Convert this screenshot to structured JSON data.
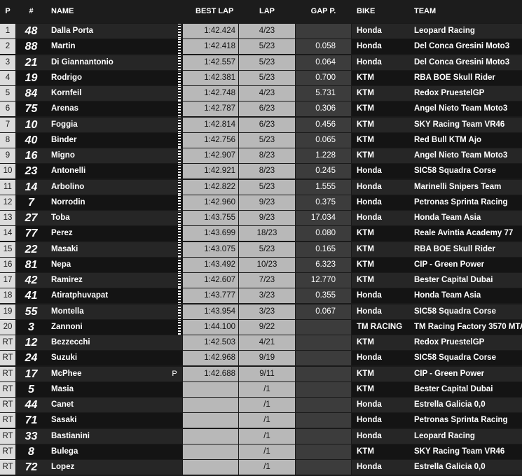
{
  "headers": {
    "pos": "P",
    "num": "#",
    "name": "NAME",
    "best_lap": "BEST LAP",
    "lap": "LAP",
    "gap": "GAP P.",
    "bike": "BIKE",
    "team": "TEAM"
  },
  "rows": [
    {
      "pos": "1",
      "num": "48",
      "name": "Dalla Porta",
      "best": "1:42.424",
      "lap": "4/23",
      "gap": "",
      "bike": "Honda",
      "team": "Leopard Racing"
    },
    {
      "pos": "2",
      "num": "88",
      "name": "Martin",
      "best": "1:42.418",
      "lap": "5/23",
      "gap": "0.058",
      "bike": "Honda",
      "team": "Del Conca Gresini Moto3"
    },
    {
      "pos": "3",
      "num": "21",
      "name": "Di Giannantonio",
      "best": "1:42.557",
      "lap": "5/23",
      "gap": "0.064",
      "bike": "Honda",
      "team": "Del Conca Gresini Moto3"
    },
    {
      "pos": "4",
      "num": "19",
      "name": "Rodrigo",
      "best": "1:42.381",
      "lap": "5/23",
      "gap": "0.700",
      "bike": "KTM",
      "team": "RBA BOE Skull Rider"
    },
    {
      "pos": "5",
      "num": "84",
      "name": "Kornfeil",
      "best": "1:42.748",
      "lap": "4/23",
      "gap": "5.731",
      "bike": "KTM",
      "team": "Redox PruestelGP"
    },
    {
      "pos": "6",
      "num": "75",
      "name": "Arenas",
      "best": "1:42.787",
      "lap": "6/23",
      "gap": "0.306",
      "bike": "KTM",
      "team": "Angel Nieto Team Moto3"
    },
    {
      "pos": "7",
      "num": "10",
      "name": "Foggia",
      "best": "1:42.814",
      "lap": "6/23",
      "gap": "0.456",
      "bike": "KTM",
      "team": "SKY Racing Team VR46"
    },
    {
      "pos": "8",
      "num": "40",
      "name": "Binder",
      "best": "1:42.756",
      "lap": "5/23",
      "gap": "0.065",
      "bike": "KTM",
      "team": "Red Bull KTM Ajo"
    },
    {
      "pos": "9",
      "num": "16",
      "name": "Migno",
      "best": "1:42.907",
      "lap": "8/23",
      "gap": "1.228",
      "bike": "KTM",
      "team": "Angel Nieto Team Moto3"
    },
    {
      "pos": "10",
      "num": "23",
      "name": "Antonelli",
      "best": "1:42.921",
      "lap": "8/23",
      "gap": "0.245",
      "bike": "Honda",
      "team": "SIC58 Squadra Corse"
    },
    {
      "pos": "11",
      "num": "14",
      "name": "Arbolino",
      "best": "1:42.822",
      "lap": "5/23",
      "gap": "1.555",
      "bike": "Honda",
      "team": "Marinelli Snipers Team"
    },
    {
      "pos": "12",
      "num": "7",
      "name": "Norrodin",
      "best": "1:42.960",
      "lap": "9/23",
      "gap": "0.375",
      "bike": "Honda",
      "team": "Petronas Sprinta Racing"
    },
    {
      "pos": "13",
      "num": "27",
      "name": "Toba",
      "best": "1:43.755",
      "lap": "9/23",
      "gap": "17.034",
      "bike": "Honda",
      "team": "Honda Team Asia"
    },
    {
      "pos": "14",
      "num": "77",
      "name": "Perez",
      "best": "1:43.699",
      "lap": "18/23",
      "gap": "0.080",
      "bike": "KTM",
      "team": "Reale Avintia Academy 77"
    },
    {
      "pos": "15",
      "num": "22",
      "name": "Masaki",
      "best": "1:43.075",
      "lap": "5/23",
      "gap": "0.165",
      "bike": "KTM",
      "team": "RBA BOE Skull Rider"
    },
    {
      "pos": "16",
      "num": "81",
      "name": "Nepa",
      "best": "1:43.492",
      "lap": "10/23",
      "gap": "6.323",
      "bike": "KTM",
      "team": "CIP - Green Power"
    },
    {
      "pos": "17",
      "num": "42",
      "name": "Ramirez",
      "best": "1:42.607",
      "lap": "7/23",
      "gap": "12.770",
      "bike": "KTM",
      "team": "Bester Capital Dubai"
    },
    {
      "pos": "18",
      "num": "41",
      "name": "Atiratphuvapat",
      "best": "1:43.777",
      "lap": "3/23",
      "gap": "0.355",
      "bike": "Honda",
      "team": "Honda Team Asia"
    },
    {
      "pos": "19",
      "num": "55",
      "name": "Montella",
      "best": "1:43.954",
      "lap": "3/23",
      "gap": "0.067",
      "bike": "Honda",
      "team": "SIC58 Squadra Corse"
    },
    {
      "pos": "20",
      "num": "3",
      "name": "Zannoni",
      "best": "1:44.100",
      "lap": "9/22",
      "gap": "",
      "bike": "TM RACING",
      "team": "TM Racing Factory 3570 MTA"
    },
    {
      "pos": "RT",
      "num": "12",
      "name": "Bezzecchi",
      "best": "1:42.503",
      "lap": "4/21",
      "gap": "",
      "bike": "KTM",
      "team": "Redox PruestelGP"
    },
    {
      "pos": "RT",
      "num": "24",
      "name": "Suzuki",
      "best": "1:42.968",
      "lap": "9/19",
      "gap": "",
      "bike": "Honda",
      "team": "SIC58 Squadra Corse"
    },
    {
      "pos": "RT",
      "num": "17",
      "name": "McPhee",
      "best": "1:42.688",
      "lap": "9/11",
      "gap": "",
      "bike": "KTM",
      "team": "CIP - Green Power",
      "pole": "P"
    },
    {
      "pos": "RT",
      "num": "5",
      "name": "Masia",
      "best": "",
      "lap": "/1",
      "gap": "",
      "bike": "KTM",
      "team": "Bester Capital Dubai"
    },
    {
      "pos": "RT",
      "num": "44",
      "name": "Canet",
      "best": "",
      "lap": "/1",
      "gap": "",
      "bike": "Honda",
      "team": "Estrella Galicia 0,0"
    },
    {
      "pos": "RT",
      "num": "71",
      "name": "Sasaki",
      "best": "",
      "lap": "/1",
      "gap": "",
      "bike": "Honda",
      "team": "Petronas Sprinta Racing"
    },
    {
      "pos": "RT",
      "num": "33",
      "name": "Bastianini",
      "best": "",
      "lap": "/1",
      "gap": "",
      "bike": "Honda",
      "team": "Leopard Racing"
    },
    {
      "pos": "RT",
      "num": "8",
      "name": "Bulega",
      "best": "",
      "lap": "/1",
      "gap": "",
      "bike": "KTM",
      "team": "SKY Racing Team VR46"
    },
    {
      "pos": "RT",
      "num": "72",
      "name": "Lopez",
      "best": "",
      "lap": "/1",
      "gap": "",
      "bike": "Honda",
      "team": "Estrella Galicia 0,0"
    }
  ],
  "colors": {
    "header_bg": "#1c1c1c",
    "row_dark": "#262626",
    "row_black": "#141414",
    "pos_cell": "#dcdcdc",
    "lap_cells": "#b8b8b8",
    "gap_cell": "#3c3c3c",
    "text": "#ffffff"
  }
}
